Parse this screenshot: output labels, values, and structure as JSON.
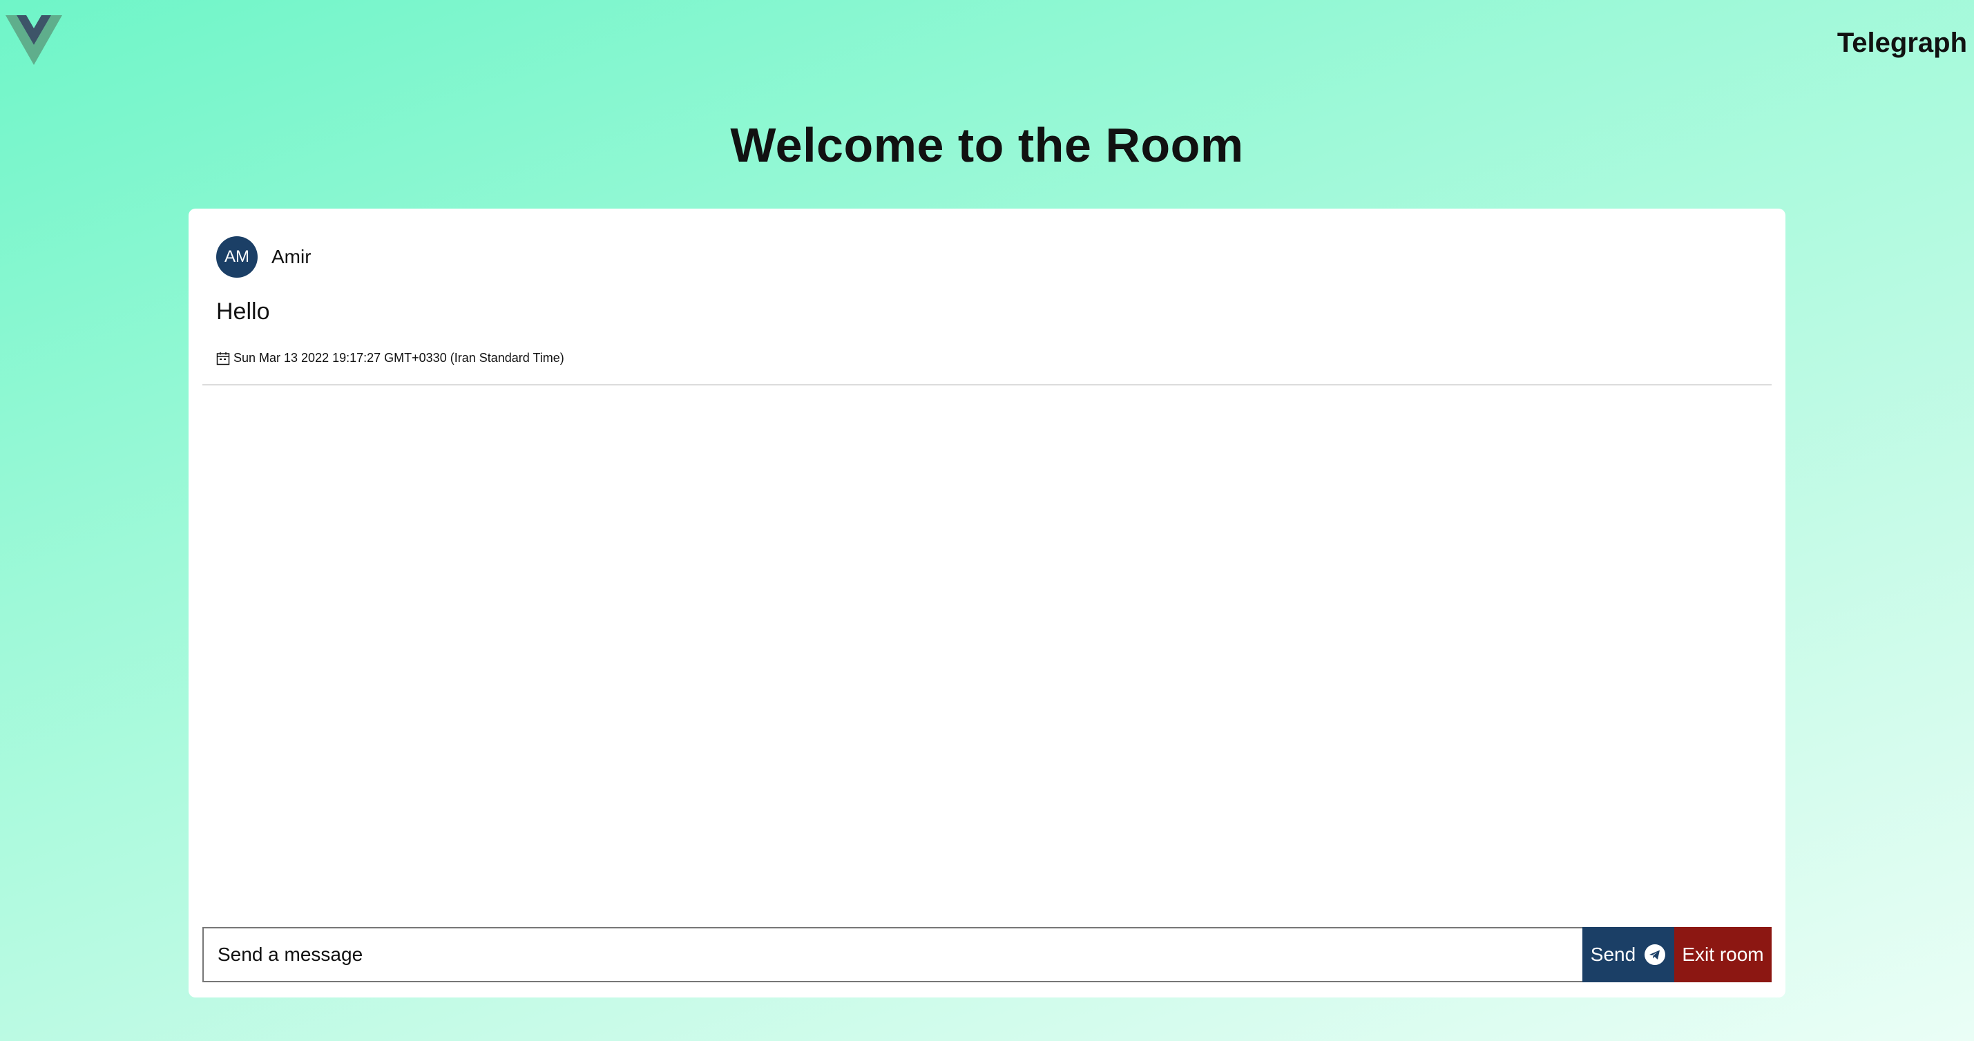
{
  "header": {
    "brand": "Telegraph",
    "logo_icon": "vue-logo-icon"
  },
  "page": {
    "title": "Welcome to the Room"
  },
  "messages": [
    {
      "avatar_initials": "AM",
      "sender": "Amir",
      "text": "Hello",
      "timestamp": "Sun Mar 13 2022 19:17:27 GMT+0330 (Iran Standard Time)",
      "timestamp_icon": "calendar-icon"
    }
  ],
  "composer": {
    "value": "Send a message",
    "send_label": "Send",
    "send_icon": "telegram-send-icon",
    "exit_label": "Exit room"
  },
  "colors": {
    "avatar_bg": "#1b3f66",
    "send_bg": "#1b3f66",
    "exit_bg": "#8c1712",
    "logo_outer": "#41b883",
    "logo_inner": "#35495e"
  }
}
